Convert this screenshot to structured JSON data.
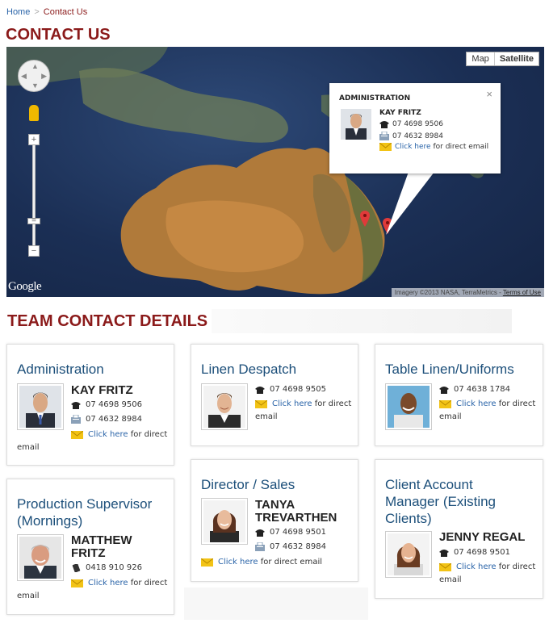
{
  "breadcrumb": {
    "home": "Home",
    "current": "Contact Us"
  },
  "page_title": "CONTACT US",
  "map": {
    "type_map": "Map",
    "type_satellite": "Satellite",
    "logo": "Google",
    "attribution": "Imagery ©2013 NASA, TerraMetrics -",
    "terms": "Terms of Use",
    "popup": {
      "title": "ADMINISTRATION",
      "name": "KAY FRITZ",
      "phone": "07 4698 9506",
      "fax": "07 4632 8984",
      "email_link": "Click here",
      "email_suffix": "for direct email"
    }
  },
  "section_title": "TEAM CONTACT DETAILS",
  "cards": [
    {
      "title": "Administration",
      "name": "KAY FRITZ",
      "phone": "07 4698 9506",
      "fax": "07 4632 8984",
      "email_link": "Click here",
      "email_tail": "for direct",
      "email_wrap": "email"
    },
    {
      "title": "Linen Despatch",
      "phone": "07 4698 9505",
      "email_link": "Click here",
      "email_tail": "for direct",
      "email_wrap": "email"
    },
    {
      "title": "Table Linen/Uniforms",
      "phone": "07 4638 1784",
      "email_link": "Click here",
      "email_tail": "for direct",
      "email_wrap": "email"
    },
    {
      "title_1": "Production Supervisor",
      "title_2": "(Mornings)",
      "name_1": "MATTHEW",
      "name_2": "FRITZ",
      "mobile": "0418 910 926",
      "email_link": "Click here",
      "email_tail": "for direct",
      "email_wrap": "email"
    },
    {
      "title": "Director / Sales",
      "name_1": "TANYA",
      "name_2": "TREVARTHEN",
      "phone": "07 4698 9501",
      "fax": "07 4632 8984",
      "email_link": "Click here",
      "email_tail": "for direct email"
    },
    {
      "title_1": "Client Account",
      "title_2": "Manager (Existing",
      "title_3": "Clients)",
      "name": "JENNY REGAL",
      "phone": "07 4698 9501",
      "email_link": "Click here",
      "email_tail": "for direct",
      "email_wrap": "email"
    }
  ]
}
